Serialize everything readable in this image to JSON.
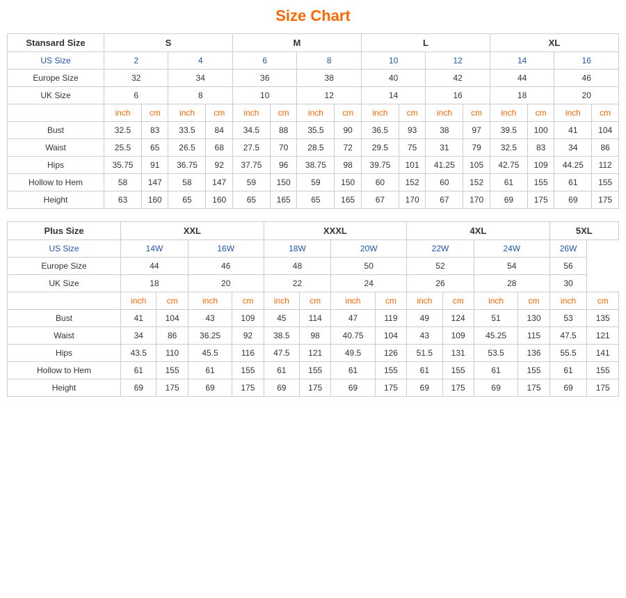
{
  "title": "Size Chart",
  "standard": {
    "header": "Stansard Size",
    "sizes": [
      "S",
      "M",
      "L",
      "XL"
    ],
    "usSize": {
      "label": "US Size",
      "values": [
        "2",
        "4",
        "6",
        "8",
        "10",
        "12",
        "14",
        "16"
      ]
    },
    "europeSize": {
      "label": "Europe Size",
      "values": [
        "32",
        "34",
        "36",
        "38",
        "40",
        "42",
        "44",
        "46"
      ]
    },
    "ukSize": {
      "label": "UK Size",
      "values": [
        "6",
        "8",
        "10",
        "12",
        "14",
        "16",
        "18",
        "20"
      ]
    },
    "subheader": {
      "inch": "inch",
      "cm": "cm"
    },
    "measurements": [
      {
        "label": "Bust",
        "values": [
          "32.5",
          "83",
          "33.5",
          "84",
          "34.5",
          "88",
          "35.5",
          "90",
          "36.5",
          "93",
          "38",
          "97",
          "39.5",
          "100",
          "41",
          "104"
        ]
      },
      {
        "label": "Waist",
        "values": [
          "25.5",
          "65",
          "26.5",
          "68",
          "27.5",
          "70",
          "28.5",
          "72",
          "29.5",
          "75",
          "31",
          "79",
          "32.5",
          "83",
          "34",
          "86"
        ]
      },
      {
        "label": "Hips",
        "values": [
          "35.75",
          "91",
          "36.75",
          "92",
          "37.75",
          "96",
          "38.75",
          "98",
          "39.75",
          "101",
          "41.25",
          "105",
          "42.75",
          "109",
          "44.25",
          "112"
        ]
      },
      {
        "label": "Hollow to Hem",
        "values": [
          "58",
          "147",
          "58",
          "147",
          "59",
          "150",
          "59",
          "150",
          "60",
          "152",
          "60",
          "152",
          "61",
          "155",
          "61",
          "155"
        ]
      },
      {
        "label": "Height",
        "values": [
          "63",
          "160",
          "65",
          "160",
          "65",
          "165",
          "65",
          "165",
          "67",
          "170",
          "67",
          "170",
          "69",
          "175",
          "69",
          "175"
        ]
      }
    ]
  },
  "plus": {
    "header": "Plus Size",
    "sizes": [
      "XXL",
      "XXXL",
      "4XL",
      "5XL"
    ],
    "usSize": {
      "label": "US Size",
      "values": [
        "14W",
        "16W",
        "18W",
        "20W",
        "22W",
        "24W",
        "26W"
      ]
    },
    "europeSize": {
      "label": "Europe Size",
      "values": [
        "44",
        "46",
        "48",
        "50",
        "52",
        "54",
        "56"
      ]
    },
    "ukSize": {
      "label": "UK Size",
      "values": [
        "18",
        "20",
        "22",
        "24",
        "26",
        "28",
        "30"
      ]
    },
    "subheader": {
      "inch": "inch",
      "cm": "cm"
    },
    "measurements": [
      {
        "label": "Bust",
        "values": [
          "41",
          "104",
          "43",
          "109",
          "45",
          "114",
          "47",
          "119",
          "49",
          "124",
          "51",
          "130",
          "53",
          "135"
        ]
      },
      {
        "label": "Waist",
        "values": [
          "34",
          "86",
          "36.25",
          "92",
          "38.5",
          "98",
          "40.75",
          "104",
          "43",
          "109",
          "45.25",
          "115",
          "47.5",
          "121"
        ]
      },
      {
        "label": "Hips",
        "values": [
          "43.5",
          "110",
          "45.5",
          "116",
          "47.5",
          "121",
          "49.5",
          "126",
          "51.5",
          "131",
          "53.5",
          "136",
          "55.5",
          "141"
        ]
      },
      {
        "label": "Hollow to Hem",
        "values": [
          "61",
          "155",
          "61",
          "155",
          "61",
          "155",
          "61",
          "155",
          "61",
          "155",
          "61",
          "155",
          "61",
          "155"
        ]
      },
      {
        "label": "Height",
        "values": [
          "69",
          "175",
          "69",
          "175",
          "69",
          "175",
          "69",
          "175",
          "69",
          "175",
          "69",
          "175",
          "69",
          "175"
        ]
      }
    ]
  }
}
